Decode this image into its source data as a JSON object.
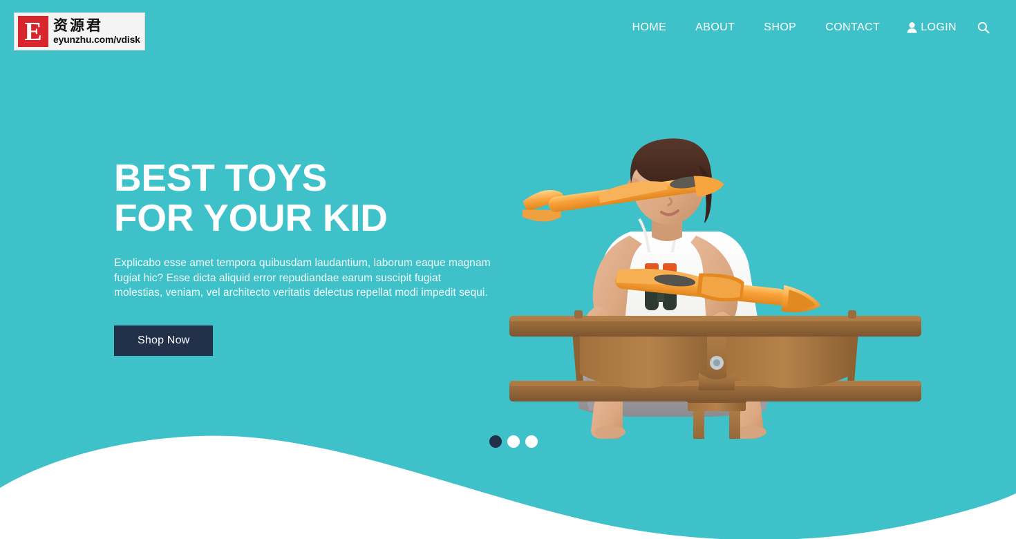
{
  "theme": {
    "background": "#3fc1c9",
    "wave": "#ffffff",
    "button": "#23304a",
    "text_light": "#ffffff"
  },
  "header": {
    "logo": {
      "mark_letter": "E",
      "chinese_name": "资源君",
      "url": "eyunzhu.com/vdisk"
    },
    "nav": [
      {
        "label": "HOME",
        "name": "nav-home"
      },
      {
        "label": "ABOUT",
        "name": "nav-about"
      },
      {
        "label": "SHOP",
        "name": "nav-shop"
      },
      {
        "label": "CONTACT",
        "name": "nav-contact"
      }
    ],
    "login": {
      "label": "LOGIN",
      "icon": "user-icon"
    },
    "search": {
      "icon": "search-icon"
    }
  },
  "hero": {
    "title": "BEST TOYS FOR YOUR KID",
    "description": "Explicabo esse amet tempora quibusdam laudantium, laborum eaque magnam fugiat hic? Esse dicta aliquid error repudiandae earum suscipit fugiat molestias, veniam, vel architecto veritatis delectus repellat modi impedit sequi.",
    "cta_label": "Shop Now",
    "image_alt": "child sitting on wooden toy biplane holding two orange foam gliders"
  },
  "carousel": {
    "total_slides": 3,
    "active_index": 0,
    "dot_active_color": "#22304a",
    "dot_inactive_color": "#ffffff"
  }
}
